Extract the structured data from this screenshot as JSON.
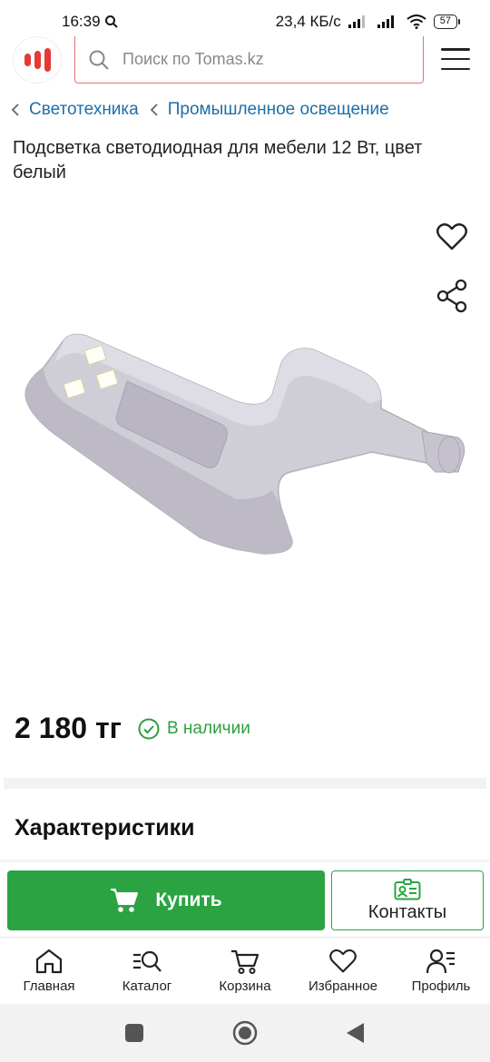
{
  "status_bar": {
    "time": "16:39",
    "network_speed": "23,4 КБ/с",
    "battery": "57"
  },
  "header": {
    "search_placeholder": "Поиск по Tomas.kz"
  },
  "breadcrumb": [
    {
      "label": "Светотехника"
    },
    {
      "label": "Промышленное освещение"
    }
  ],
  "product": {
    "title": "Подсветка светодиодная для мебели 12 Вт, цвет белый",
    "price": "2 180 тг",
    "stock_status": "В наличии"
  },
  "section": {
    "characteristics_title": "Характеристики"
  },
  "actions": {
    "buy_label": "Купить",
    "contacts_label": "Контакты"
  },
  "bottom_nav": [
    {
      "label": "Главная",
      "icon": "home-icon"
    },
    {
      "label": "Каталог",
      "icon": "catalog-search-icon"
    },
    {
      "label": "Корзина",
      "icon": "cart-icon"
    },
    {
      "label": "Избранное",
      "icon": "heart-icon"
    },
    {
      "label": "Профиль",
      "icon": "profile-icon"
    }
  ],
  "colors": {
    "accent_green": "#2ba342",
    "link_blue": "#1e6fa8",
    "brand_red": "#e53935"
  }
}
